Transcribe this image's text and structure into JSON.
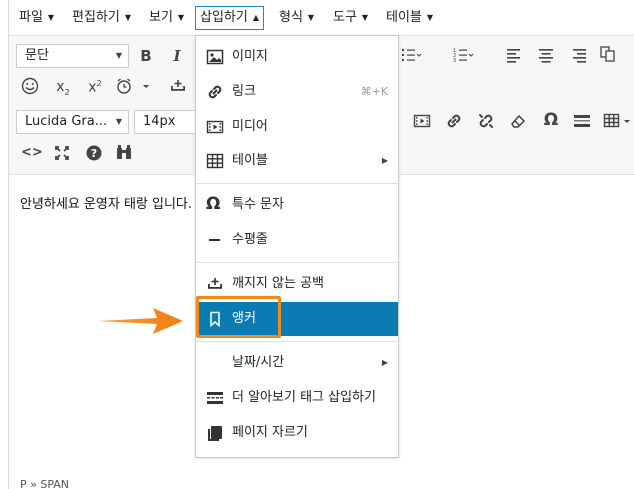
{
  "menubar": {
    "items": [
      "파일",
      "편집하기",
      "보기",
      "삽입하기",
      "형식",
      "도구",
      "테이블"
    ]
  },
  "toolbar": {
    "block_format": "문단",
    "font_family": "Lucida Gra...",
    "font_size": "14px"
  },
  "content": {
    "text": "안녕하세요 운영자 태랑 입니다."
  },
  "statusbar": {
    "path": "P » SPAN"
  },
  "insert_menu": {
    "items": [
      {
        "label": "이미지",
        "icon": "image-icon"
      },
      {
        "label": "링크",
        "icon": "link-icon",
        "shortcut": "⌘+K"
      },
      {
        "label": "미디어",
        "icon": "media-icon"
      },
      {
        "label": "테이블",
        "icon": "table-icon",
        "submenu": true
      },
      {
        "label": "특수 문자",
        "icon": "omega-icon"
      },
      {
        "label": "수평줄",
        "icon": "horizontal-rule-icon"
      },
      {
        "label": "깨지지 않는 공백",
        "icon": "nonbreaking-space-icon"
      },
      {
        "label": "앵커",
        "icon": "bookmark-icon",
        "highlighted": true
      },
      {
        "label": "날짜/시간",
        "icon": "",
        "submenu": true
      },
      {
        "label": "더 알아보기 태그 삽입하기",
        "icon": "read-more-icon"
      },
      {
        "label": "페이지 자르기",
        "icon": "page-break-icon"
      }
    ]
  },
  "colors": {
    "highlight": "#0a7bb3",
    "annotation": "#f08a1e",
    "active_border": "#2a86c2"
  }
}
